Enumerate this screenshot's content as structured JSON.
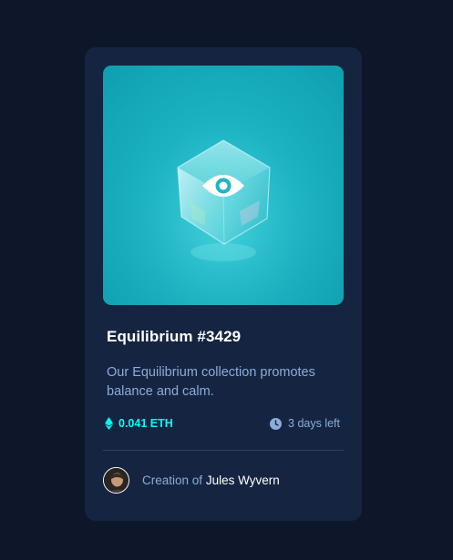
{
  "card": {
    "image_alt": "Equilibrium cube image",
    "overlay_icon": "eye-icon",
    "title": "Equilibrium #3429",
    "description": "Our Equilibrium collection promotes balance and calm.",
    "price": "0.041 ETH",
    "price_icon": "ethereum-icon",
    "time_left": "3 days left",
    "time_icon": "clock-icon",
    "creator_prefix": "Creation of",
    "creator_name": "Jules Wyvern"
  },
  "colors": {
    "page_bg": "#0e1729",
    "card_bg": "#152541",
    "accent_cyan": "#00fff8",
    "soft_blue": "#8bacd9",
    "white": "#ffffff"
  }
}
